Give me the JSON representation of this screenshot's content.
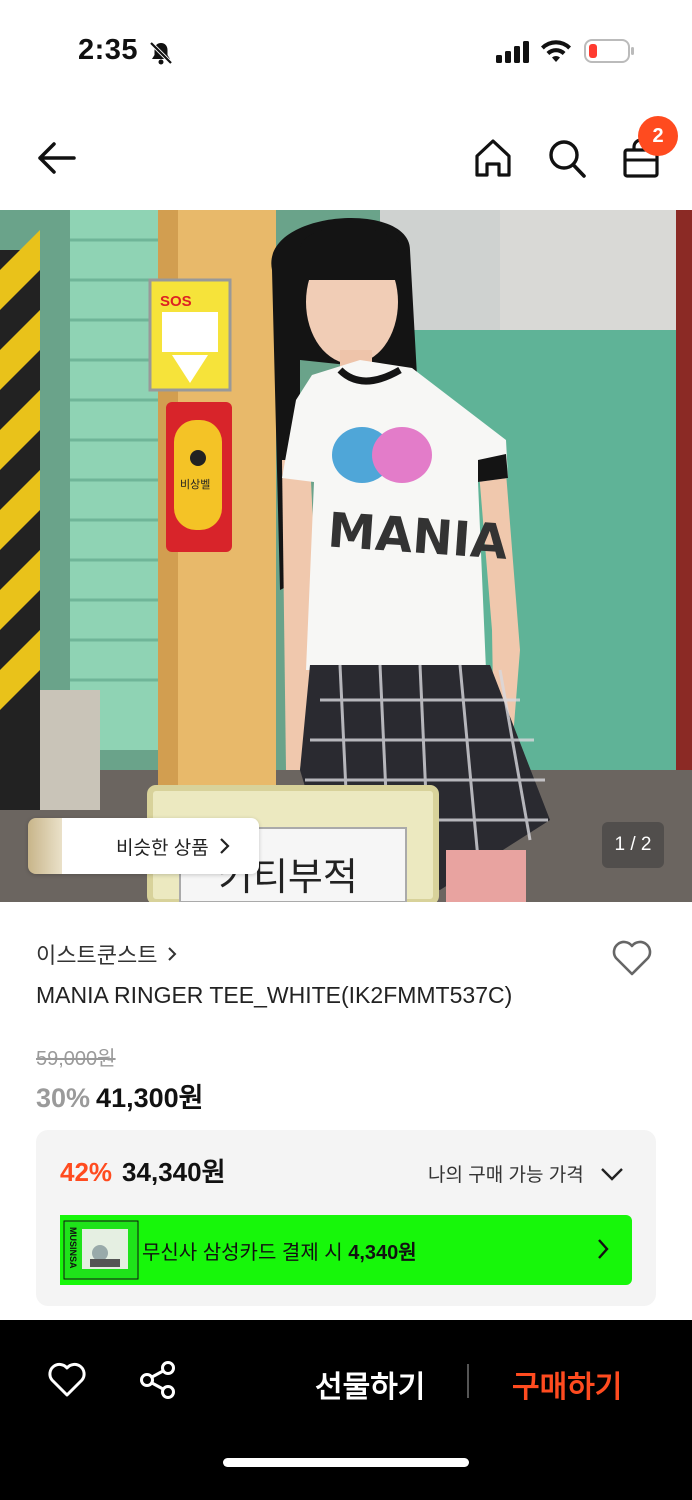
{
  "status_bar": {
    "time": "2:35"
  },
  "nav": {
    "cart_badge": "2"
  },
  "hero": {
    "similar_label": "비슷한 상품",
    "pager": "1 / 2",
    "sign_text": "키티부적",
    "shirt_text": "MANIA",
    "sos_text": "SOS",
    "bell_text": "비상벨"
  },
  "product": {
    "brand": "이스트쿤스트",
    "name": "MANIA RINGER TEE_WHITE(IK2FMMT537C)",
    "original_price": "59,000원",
    "discount": "30%",
    "price": "41,300원"
  },
  "benefit": {
    "discount": "42%",
    "price": "34,340원",
    "my_price_label": "나의 구매 가능 가격",
    "card_text_prefix": "무신사 삼성카드 결제 시 ",
    "card_text_amount": "4,340원",
    "card_logo_text": "MUSINSA"
  },
  "bottom_bar": {
    "gift_label": "선물하기",
    "buy_label": "구매하기"
  },
  "colors": {
    "accent": "#ff4b1f",
    "card_banner": "#17f70a"
  }
}
